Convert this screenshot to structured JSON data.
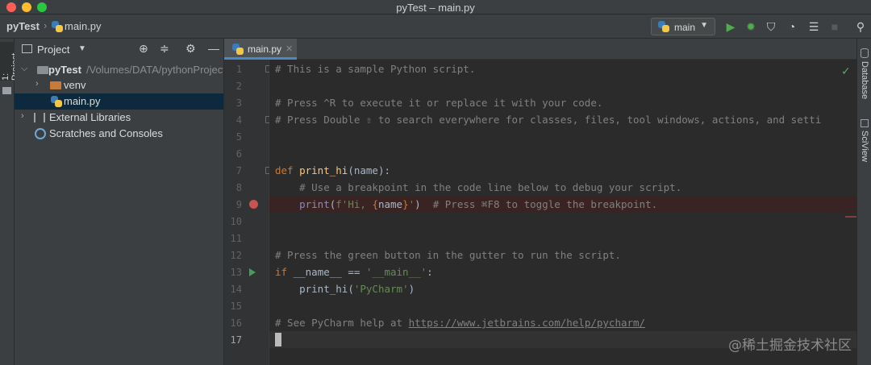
{
  "window": {
    "title": "pyTest – main.py"
  },
  "navbar": {
    "project": "pyTest",
    "file": "main.py",
    "run_config": "main"
  },
  "toolbar_icons": [
    "run-icon",
    "debug-icon",
    "coverage-icon",
    "profile-icon",
    "concurrency-icon",
    "stop-icon",
    "search-icon"
  ],
  "left_strip": {
    "tab": "1: Project"
  },
  "project_panel": {
    "title": "Project",
    "tree": {
      "root": "pyTest",
      "root_path": "/Volumes/DATA/pythonProject",
      "venv": "venv",
      "main": "main.py",
      "external": "External Libraries",
      "scratches": "Scratches and Consoles"
    }
  },
  "editor": {
    "tab": "main.py",
    "line_numbers": [
      "1",
      "2",
      "3",
      "4",
      "5",
      "6",
      "7",
      "8",
      "9",
      "10",
      "11",
      "12",
      "13",
      "14",
      "15",
      "16",
      "17"
    ],
    "breakpoint_line": 9,
    "run_line": 13,
    "current_line": 17,
    "lines": {
      "l1": "# This is a sample Python script.",
      "l3": "# Press ^R to execute it or replace it with your code.",
      "l4": "# Press Double ⇧ to search everywhere for classes, files, tool windows, actions, and setti",
      "l7_kw": "def",
      "l7_fn": "print_hi",
      "l7_rest": "(name):",
      "l8": "    # Use a breakpoint in the code line below to debug your script.",
      "l9_indent": "    ",
      "l9_print": "print",
      "l9_open": "(",
      "l9_str_a": "f'Hi, ",
      "l9_brace_open": "{",
      "l9_name": "name",
      "l9_brace_close": "}",
      "l9_str_b": "'",
      "l9_close": ")",
      "l9_comment": "  # Press ⌘F8 to toggle the breakpoint.",
      "l12": "# Press the green button in the gutter to run the script.",
      "l13_kw": "if",
      "l13_dunder": " __name__",
      "l13_op": " == ",
      "l13_str": "'__main__'",
      "l13_end": ":",
      "l14_indent": "    ",
      "l14_fn": "print_hi",
      "l14_open": "(",
      "l14_str": "'PyCharm'",
      "l14_close": ")",
      "l16_cmt": "# See PyCharm help at ",
      "l16_link": "https://www.jetbrains.com/help/pycharm/"
    }
  },
  "right_strip": {
    "tab1": "Database",
    "tab2": "SciView"
  },
  "watermark": "@稀土掘金技术社区",
  "colors": {
    "accent": "#4a88c7",
    "breakpoint": "#c75450",
    "run": "#499c54",
    "keyword": "#cc7832",
    "comment": "#808080",
    "string": "#6a8759"
  }
}
